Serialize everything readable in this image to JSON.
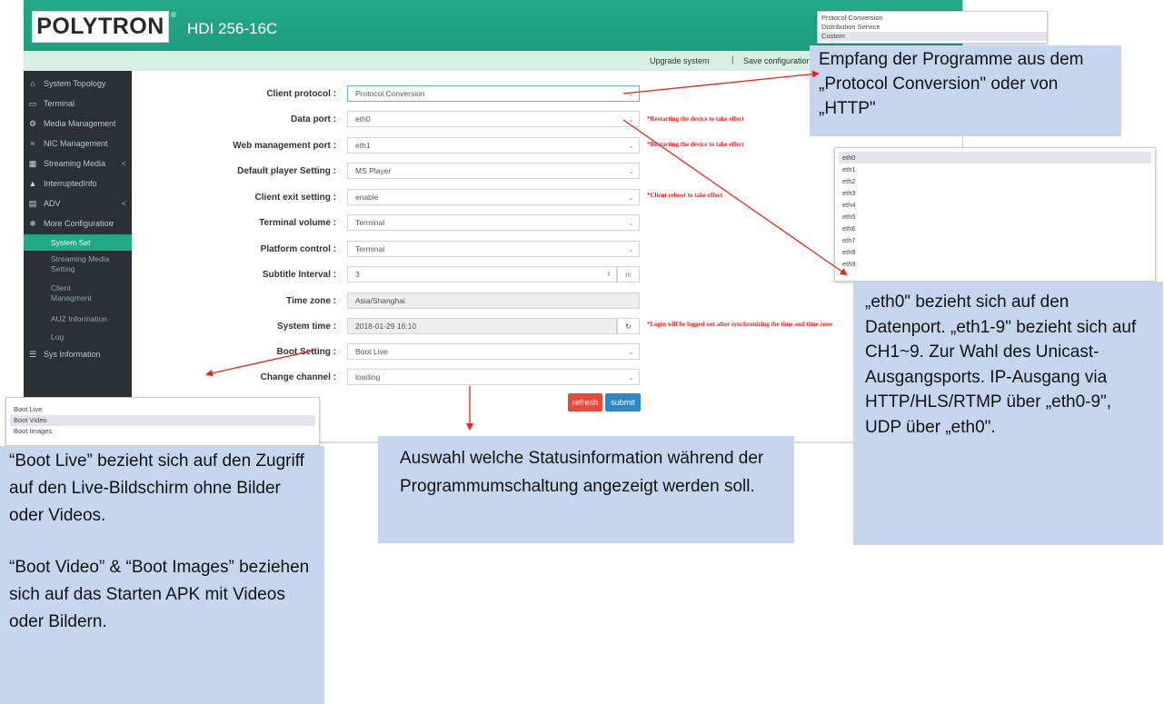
{
  "header": {
    "logo": "POLYTRON",
    "logo_reg": "®",
    "product": "HDI 256-16C"
  },
  "topbar": {
    "upgrade": "Upgrade system",
    "separator": "|",
    "save": "Save configuration"
  },
  "sidebar": {
    "items": [
      {
        "label": "System Topology",
        "icon": "home-icon"
      },
      {
        "label": "Terminal",
        "icon": "monitor-icon"
      },
      {
        "label": "Media Management",
        "icon": "gear-icon"
      },
      {
        "label": "NIC Management",
        "icon": "wifi-icon"
      },
      {
        "label": "Streaming Media",
        "icon": "film-icon",
        "arrow": "<"
      },
      {
        "label": "InterruptedInfo",
        "icon": "bell-icon"
      },
      {
        "label": "ADV",
        "icon": "card-icon",
        "arrow": "<"
      },
      {
        "label": "More Configuration",
        "icon": "gears-icon",
        "arrow": "v"
      }
    ],
    "subitems": [
      "System Set",
      "Streaming Media Setting",
      "Client Managment",
      "AUZ Information",
      "Log"
    ],
    "sys_info": "Sys Information"
  },
  "form": {
    "client_protocol": {
      "label": "Client protocol :",
      "value": "Protocol Conversion"
    },
    "data_port": {
      "label": "Data port :",
      "value": "eth0",
      "note": "*Restarting the device to take effect"
    },
    "web_port": {
      "label": "Web management port :",
      "value": "eth1",
      "note": "*Restarting the device to take effect"
    },
    "default_player": {
      "label": "Default player Setting :",
      "value": "MS Player"
    },
    "client_exit": {
      "label": "Client exit setting :",
      "value": "enable",
      "note": "*Client reboot to take effect"
    },
    "terminal_volume": {
      "label": "Terminal volume :",
      "value": "Terminal"
    },
    "platform_control": {
      "label": "Platform control :",
      "value": "Terminal"
    },
    "subtitle_interval": {
      "label": "Subtitle Interval :",
      "value": "3",
      "unit": "m"
    },
    "time_zone": {
      "label": "Time zone :",
      "value": "Asia/Shanghai"
    },
    "system_time": {
      "label": "System time :",
      "value": "2018-01-29 16:10",
      "note": "*Login will be logged out after synchronizing the time and time zone"
    },
    "boot_setting": {
      "label": "Boot Setting :",
      "value": "Boot Live"
    },
    "change_channel": {
      "label": "Change channel :",
      "value": "loading"
    },
    "refresh": "refresh",
    "submit": "submit"
  },
  "popups": {
    "protocol": [
      "Protocol Conversion",
      "Distribution Service",
      "Custom"
    ],
    "eth": [
      "eth0",
      "eth1",
      "eth2",
      "eth3",
      "eth4",
      "eth5",
      "eth6",
      "eth7",
      "eth8",
      "eth9"
    ],
    "boot": [
      "Boot Live",
      "Boot Video",
      "Boot Images"
    ]
  },
  "callouts": {
    "protocol": "Empfang der Programme aus dem „Protocol Conversion\" oder von „HTTP\"",
    "eth": "„eth0\" bezieht sich auf den Datenport. „eth1-9\" bezieht sich auf CH1~9. Zur Wahl des Unicast-Ausgangsports. IP-Ausgang via HTTP/HLS/RTMP über „eth0-9\", UDP über „eth0\".",
    "channel": "Auswahl welche Statusinformation während der Programmumschaltung angezeigt werden soll.",
    "boot_1": "“Boot Live” bezieht sich auf den Zugriff auf den Live-Bildschirm ohne Bilder oder Videos.",
    "boot_2": "“Boot Video” & “Boot Images” beziehen sich auf das Starten APK mit Videos oder Bildern."
  },
  "colors": {
    "header": "#23a986",
    "sidebar": "#2b3034",
    "note_red": "#d9241e",
    "callout_bg": "#c5d6ee",
    "refresh": "#e04c3e",
    "submit": "#2f86c0"
  }
}
